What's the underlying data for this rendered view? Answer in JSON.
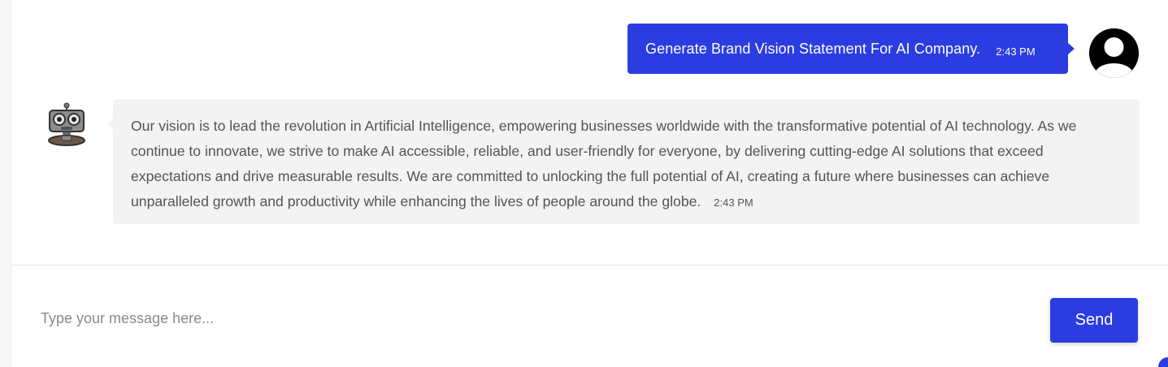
{
  "messages": {
    "user": {
      "text": "Generate Brand Vision Statement For AI Company.",
      "time": "2:43 PM"
    },
    "bot": {
      "text": "Our vision is to lead the revolution in Artificial Intelligence, empowering businesses worldwide with the transformative potential of AI technology. As we continue to innovate, we strive to make AI accessible, reliable, and user-friendly for everyone, by delivering cutting-edge AI solutions that exceed expectations and drive measurable results. We are committed to unlocking the full potential of AI, creating a future where businesses can achieve unparalleled growth and productivity while enhancing the lives of people around the globe.",
      "time": "2:43 PM"
    }
  },
  "composer": {
    "placeholder": "Type your message here...",
    "value": "",
    "send_label": "Send"
  },
  "icons": {
    "user_avatar": "user-avatar-icon",
    "bot_avatar": "robot-icon"
  },
  "colors": {
    "accent": "#2b3de0",
    "bot_bubble": "#f3f3f3",
    "user_avatar": "#000000"
  }
}
